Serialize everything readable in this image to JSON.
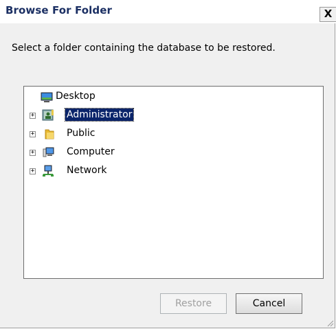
{
  "window": {
    "title": "Browse For Folder",
    "close_glyph": "X"
  },
  "instruction": "Select a folder containing the database to be restored.",
  "tree": {
    "items": [
      {
        "label": "Desktop",
        "icon": "desktop-icon",
        "expander": ""
      },
      {
        "label": "Administrator",
        "icon": "user-folder-icon",
        "expander": "+",
        "selected": true
      },
      {
        "label": "Public",
        "icon": "folder-icon",
        "expander": "+"
      },
      {
        "label": "Computer",
        "icon": "computer-icon",
        "expander": "+"
      },
      {
        "label": "Network",
        "icon": "network-icon",
        "expander": "+"
      }
    ]
  },
  "buttons": {
    "restore_label": "Restore",
    "cancel_label": "Cancel"
  },
  "colors": {
    "selection": "#0a246a",
    "title_text": "#1b2f63",
    "dialog_bg": "#f0f0f0"
  }
}
